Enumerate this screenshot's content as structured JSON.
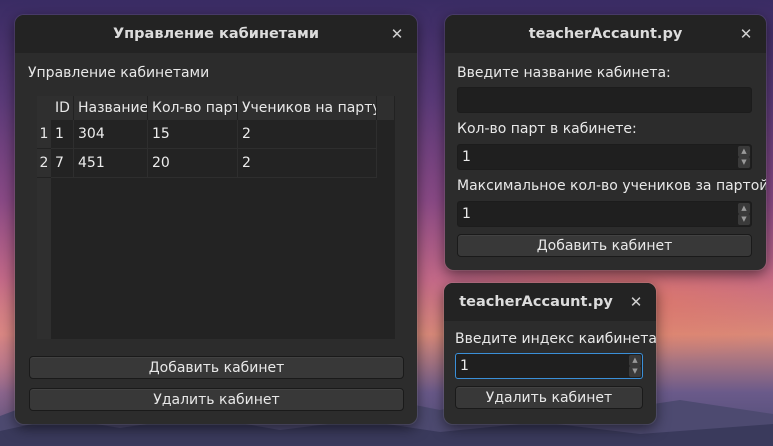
{
  "window_main": {
    "title": "Управление кабинетами",
    "heading": "Управление кабинетами",
    "table": {
      "columns": [
        "ID",
        "Название",
        "Кол-во парт",
        "Учеников на парту"
      ],
      "rows": [
        {
          "index": "1",
          "cells": [
            "1",
            "304",
            "15",
            "2"
          ]
        },
        {
          "index": "2",
          "cells": [
            "7",
            "451",
            "20",
            "2"
          ]
        }
      ]
    },
    "add_button": "Добавить кабинет",
    "delete_button": "Удалить кабинет"
  },
  "window_add": {
    "title": "teacherAccaunt.py",
    "name_label": "Введите название кабинета:",
    "name_value": "",
    "desks_label": "Кол-во парт в кабинете:",
    "desks_value": "1",
    "students_label": "Максимальное кол-во учеников за партой:",
    "students_value": "1",
    "add_button": "Добавить кабинет"
  },
  "window_delete": {
    "title": "teacherAccaunt.py",
    "index_label": "Введите индекс каибинета:",
    "index_value": "1",
    "delete_button": "Удалить кабинет"
  },
  "icons": {
    "close": "close-icon",
    "spin_up": "chevron-up-icon",
    "spin_down": "chevron-down-icon"
  },
  "colors": {
    "window_bg": "#2c2c2c",
    "titlebar_bg": "#232323",
    "focus_accent": "#3a8fd8"
  }
}
